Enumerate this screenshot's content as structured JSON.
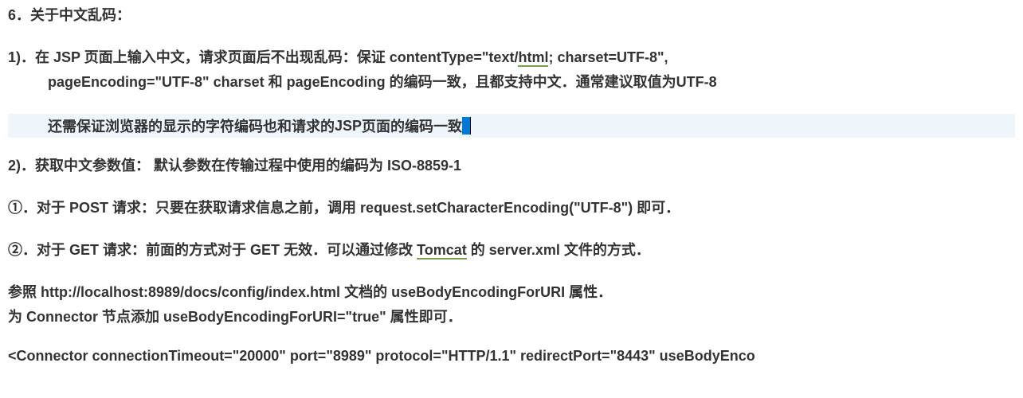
{
  "line1": "6．关于中文乱码：",
  "line3a": "1)．在 ",
  "line3b": "JSP",
  "line3c": " 页面上输入中文，请求页面后不出现乱码：保证 ",
  "line3d": "contentType=\"text/",
  "line3e": "html",
  "line3f": "; charset=UTF-8\",",
  "line4a": "pageEncoding=\"UTF-8\"  charset",
  "line4b": " 和 ",
  "line4c": "pageEncoding",
  "line4d": " 的编码一致，且都支持中文．通常建议取值为UTF-8",
  "line6a": "还需保证浏览器的显示的字符编码也和请求的 ",
  "line6b": "JSP",
  "line6c": "  页面的编码一致",
  "line8a": "2)．获取中文参数值： 默认参数在传输过程中使用的编码为 ",
  "line8b": "ISO-8859-1",
  "line10a": "①．对于 ",
  "line10b": "POST",
  "line10c": "  请求：只要在获取请求信息之前，调用 ",
  "line10d": "request.setCharacterEncoding(\"UTF-8\")",
  "line10e": "  即可．",
  "line12a": "②．对于 ",
  "line12b": "GET",
  "line12c": "  请求：前面的方式对于 ",
  "line12d": "GET",
  "line12e": "  无效．可以通过修改 ",
  "line12f": "Tomcat",
  "line12g": "  的 ",
  "line12h": "server.xml",
  "line12i": "  文件的方式．",
  "line14a": "参照 ",
  "line14b": "http://localhost:8989/docs/config/index.html",
  "line14c": "  文档的 ",
  "line14d": "useBodyEncodingForURI",
  "line14e": "  属性．",
  "line15a": "为 ",
  "line15b": "Connector",
  "line15c": "  节点添加 ",
  "line15d": "useBodyEncodingForURI=\"true\"",
  "line15e": "  属性即可．",
  "line17": "<Connector connectionTimeout=\"20000\" port=\"8989\" protocol=\"HTTP/1.1\" redirectPort=\"8443\" useBodyEnco"
}
